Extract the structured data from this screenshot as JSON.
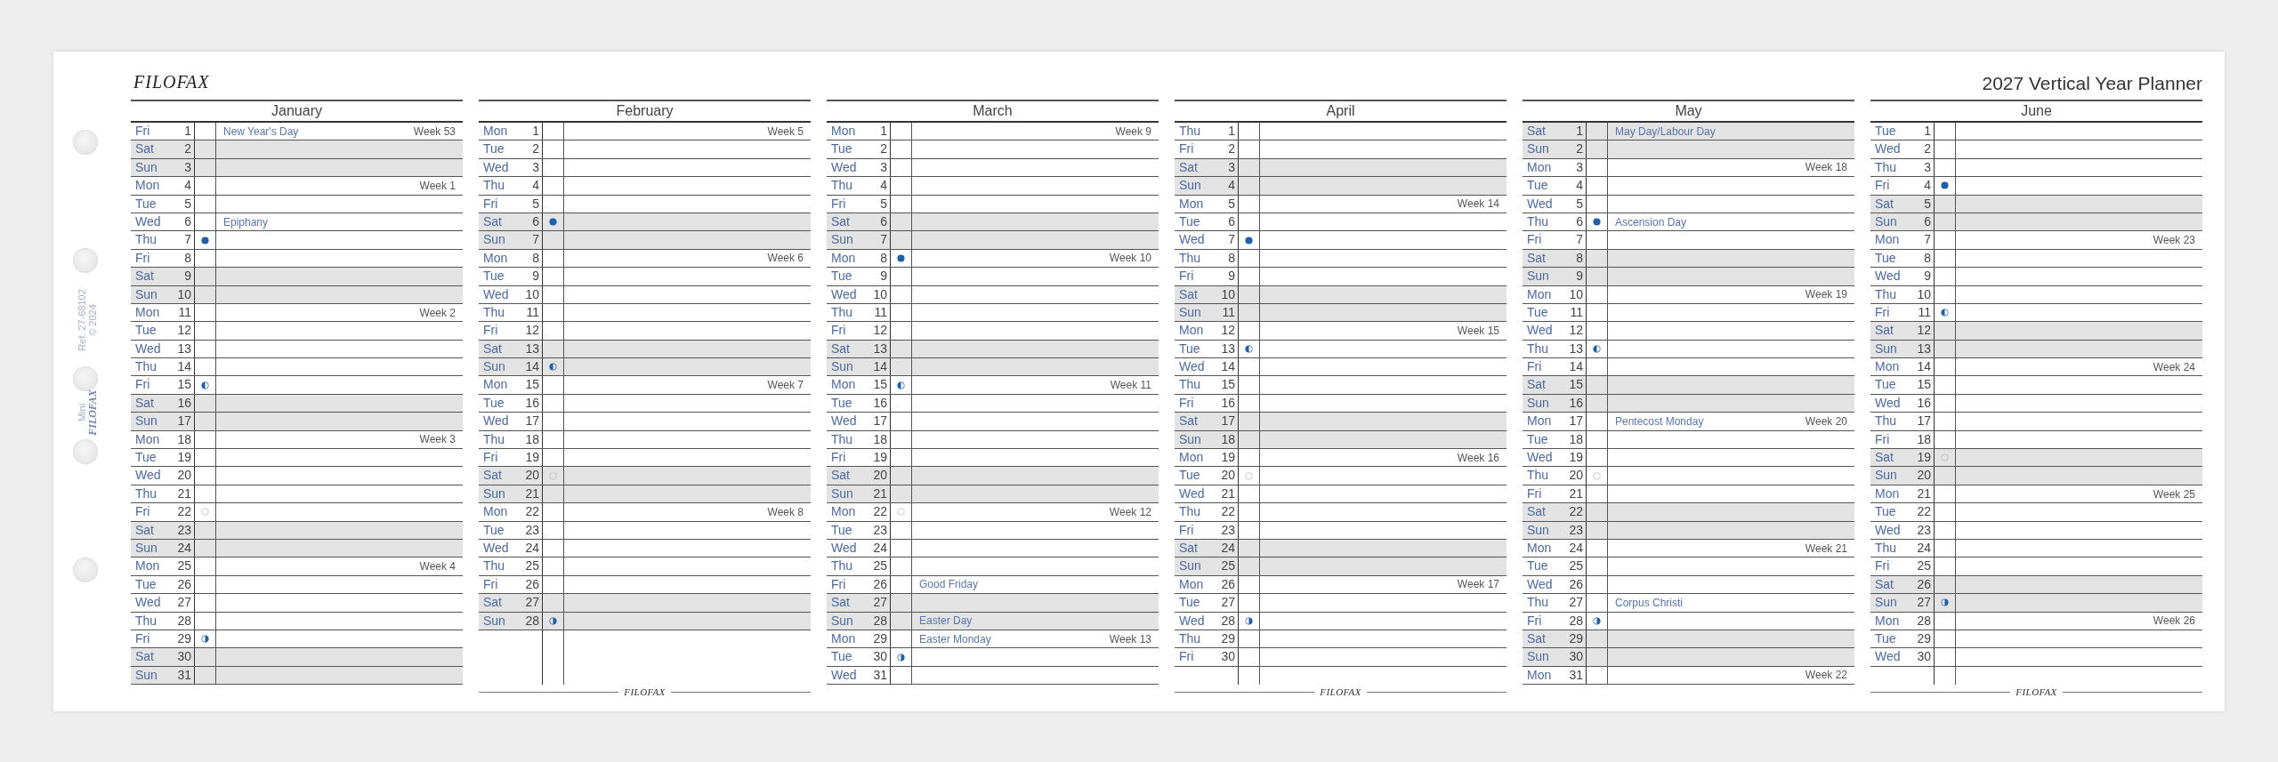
{
  "header": {
    "logo": "FILOFAX",
    "title": "2027 Vertical Year Planner"
  },
  "margin": {
    "reference": "Ref. 27-68102",
    "copyright": "© 2024",
    "edition": "Mini",
    "brand": "FILOFAX"
  },
  "months": [
    {
      "name": "January",
      "days": [
        {
          "weekday": "Fri",
          "date": "1",
          "shaded": false,
          "note": "New Year's Day",
          "week": "Week 53"
        },
        {
          "weekday": "Sat",
          "date": "2",
          "shaded": true
        },
        {
          "weekday": "Sun",
          "date": "3",
          "shaded": true
        },
        {
          "weekday": "Mon",
          "date": "4",
          "shaded": false,
          "week": "Week 1"
        },
        {
          "weekday": "Tue",
          "date": "5",
          "shaded": false
        },
        {
          "weekday": "Wed",
          "date": "6",
          "shaded": false,
          "note": "Epiphany"
        },
        {
          "weekday": "Thu",
          "date": "7",
          "shaded": false,
          "moon": {
            "kind": "new"
          }
        },
        {
          "weekday": "Fri",
          "date": "8",
          "shaded": false
        },
        {
          "weekday": "Sat",
          "date": "9",
          "shaded": true
        },
        {
          "weekday": "Sun",
          "date": "10",
          "shaded": true
        },
        {
          "weekday": "Mon",
          "date": "11",
          "shaded": false,
          "week": "Week 2"
        },
        {
          "weekday": "Tue",
          "date": "12",
          "shaded": false
        },
        {
          "weekday": "Wed",
          "date": "13",
          "shaded": false
        },
        {
          "weekday": "Thu",
          "date": "14",
          "shaded": false
        },
        {
          "weekday": "Fri",
          "date": "15",
          "shaded": false,
          "moon": {
            "kind": "first_quarter"
          }
        },
        {
          "weekday": "Sat",
          "date": "16",
          "shaded": true
        },
        {
          "weekday": "Sun",
          "date": "17",
          "shaded": true
        },
        {
          "weekday": "Mon",
          "date": "18",
          "shaded": false,
          "week": "Week 3"
        },
        {
          "weekday": "Tue",
          "date": "19",
          "shaded": false
        },
        {
          "weekday": "Wed",
          "date": "20",
          "shaded": false
        },
        {
          "weekday": "Thu",
          "date": "21",
          "shaded": false
        },
        {
          "weekday": "Fri",
          "date": "22",
          "shaded": false,
          "moon": {
            "kind": "full"
          }
        },
        {
          "weekday": "Sat",
          "date": "23",
          "shaded": true
        },
        {
          "weekday": "Sun",
          "date": "24",
          "shaded": true
        },
        {
          "weekday": "Mon",
          "date": "25",
          "shaded": false,
          "week": "Week 4"
        },
        {
          "weekday": "Tue",
          "date": "26",
          "shaded": false
        },
        {
          "weekday": "Wed",
          "date": "27",
          "shaded": false
        },
        {
          "weekday": "Thu",
          "date": "28",
          "shaded": false
        },
        {
          "weekday": "Fri",
          "date": "29",
          "shaded": false,
          "moon": {
            "kind": "last_quarter"
          }
        },
        {
          "weekday": "Sat",
          "date": "30",
          "shaded": true
        },
        {
          "weekday": "Sun",
          "date": "31",
          "shaded": true
        }
      ]
    },
    {
      "name": "February",
      "footer_logo": "FILOFAX",
      "days": [
        {
          "weekday": "Mon",
          "date": "1",
          "shaded": false,
          "week": "Week 5"
        },
        {
          "weekday": "Tue",
          "date": "2",
          "shaded": false
        },
        {
          "weekday": "Wed",
          "date": "3",
          "shaded": false
        },
        {
          "weekday": "Thu",
          "date": "4",
          "shaded": false
        },
        {
          "weekday": "Fri",
          "date": "5",
          "shaded": false
        },
        {
          "weekday": "Sat",
          "date": "6",
          "shaded": true,
          "moon": {
            "kind": "new"
          }
        },
        {
          "weekday": "Sun",
          "date": "7",
          "shaded": true
        },
        {
          "weekday": "Mon",
          "date": "8",
          "shaded": false,
          "week": "Week 6"
        },
        {
          "weekday": "Tue",
          "date": "9",
          "shaded": false
        },
        {
          "weekday": "Wed",
          "date": "10",
          "shaded": false
        },
        {
          "weekday": "Thu",
          "date": "11",
          "shaded": false
        },
        {
          "weekday": "Fri",
          "date": "12",
          "shaded": false
        },
        {
          "weekday": "Sat",
          "date": "13",
          "shaded": true
        },
        {
          "weekday": "Sun",
          "date": "14",
          "shaded": true,
          "moon": {
            "kind": "first_quarter"
          }
        },
        {
          "weekday": "Mon",
          "date": "15",
          "shaded": false,
          "week": "Week 7"
        },
        {
          "weekday": "Tue",
          "date": "16",
          "shaded": false
        },
        {
          "weekday": "Wed",
          "date": "17",
          "shaded": false
        },
        {
          "weekday": "Thu",
          "date": "18",
          "shaded": false
        },
        {
          "weekday": "Fri",
          "date": "19",
          "shaded": false
        },
        {
          "weekday": "Sat",
          "date": "20",
          "shaded": true,
          "moon": {
            "kind": "full"
          }
        },
        {
          "weekday": "Sun",
          "date": "21",
          "shaded": true
        },
        {
          "weekday": "Mon",
          "date": "22",
          "shaded": false,
          "week": "Week 8"
        },
        {
          "weekday": "Tue",
          "date": "23",
          "shaded": false
        },
        {
          "weekday": "Wed",
          "date": "24",
          "shaded": false
        },
        {
          "weekday": "Thu",
          "date": "25",
          "shaded": false
        },
        {
          "weekday": "Fri",
          "date": "26",
          "shaded": false
        },
        {
          "weekday": "Sat",
          "date": "27",
          "shaded": true
        },
        {
          "weekday": "Sun",
          "date": "28",
          "shaded": true,
          "moon": {
            "kind": "last_quarter"
          }
        }
      ]
    },
    {
      "name": "March",
      "days": [
        {
          "weekday": "Mon",
          "date": "1",
          "shaded": false,
          "week": "Week 9"
        },
        {
          "weekday": "Tue",
          "date": "2",
          "shaded": false
        },
        {
          "weekday": "Wed",
          "date": "3",
          "shaded": false
        },
        {
          "weekday": "Thu",
          "date": "4",
          "shaded": false
        },
        {
          "weekday": "Fri",
          "date": "5",
          "shaded": false
        },
        {
          "weekday": "Sat",
          "date": "6",
          "shaded": true
        },
        {
          "weekday": "Sun",
          "date": "7",
          "shaded": true
        },
        {
          "weekday": "Mon",
          "date": "8",
          "shaded": false,
          "moon": {
            "kind": "new"
          },
          "week": "Week 10"
        },
        {
          "weekday": "Tue",
          "date": "9",
          "shaded": false
        },
        {
          "weekday": "Wed",
          "date": "10",
          "shaded": false
        },
        {
          "weekday": "Thu",
          "date": "11",
          "shaded": false
        },
        {
          "weekday": "Fri",
          "date": "12",
          "shaded": false
        },
        {
          "weekday": "Sat",
          "date": "13",
          "shaded": true
        },
        {
          "weekday": "Sun",
          "date": "14",
          "shaded": true
        },
        {
          "weekday": "Mon",
          "date": "15",
          "shaded": false,
          "moon": {
            "kind": "first_quarter"
          },
          "week": "Week 11"
        },
        {
          "weekday": "Tue",
          "date": "16",
          "shaded": false
        },
        {
          "weekday": "Wed",
          "date": "17",
          "shaded": false
        },
        {
          "weekday": "Thu",
          "date": "18",
          "shaded": false
        },
        {
          "weekday": "Fri",
          "date": "19",
          "shaded": false
        },
        {
          "weekday": "Sat",
          "date": "20",
          "shaded": true
        },
        {
          "weekday": "Sun",
          "date": "21",
          "shaded": true
        },
        {
          "weekday": "Mon",
          "date": "22",
          "shaded": false,
          "moon": {
            "kind": "full"
          },
          "week": "Week 12"
        },
        {
          "weekday": "Tue",
          "date": "23",
          "shaded": false
        },
        {
          "weekday": "Wed",
          "date": "24",
          "shaded": false
        },
        {
          "weekday": "Thu",
          "date": "25",
          "shaded": false
        },
        {
          "weekday": "Fri",
          "date": "26",
          "shaded": false,
          "note": "Good Friday"
        },
        {
          "weekday": "Sat",
          "date": "27",
          "shaded": true
        },
        {
          "weekday": "Sun",
          "date": "28",
          "shaded": true,
          "note": "Easter Day"
        },
        {
          "weekday": "Mon",
          "date": "29",
          "shaded": false,
          "note": "Easter Monday",
          "week": "Week 13"
        },
        {
          "weekday": "Tue",
          "date": "30",
          "shaded": false,
          "moon": {
            "kind": "last_quarter"
          }
        },
        {
          "weekday": "Wed",
          "date": "31",
          "shaded": false
        }
      ]
    },
    {
      "name": "April",
      "footer_logo": "FILOFAX",
      "days": [
        {
          "weekday": "Thu",
          "date": "1",
          "shaded": false
        },
        {
          "weekday": "Fri",
          "date": "2",
          "shaded": false
        },
        {
          "weekday": "Sat",
          "date": "3",
          "shaded": true
        },
        {
          "weekday": "Sun",
          "date": "4",
          "shaded": true
        },
        {
          "weekday": "Mon",
          "date": "5",
          "shaded": false,
          "week": "Week 14"
        },
        {
          "weekday": "Tue",
          "date": "6",
          "shaded": false
        },
        {
          "weekday": "Wed",
          "date": "7",
          "shaded": false,
          "moon": {
            "kind": "new"
          }
        },
        {
          "weekday": "Thu",
          "date": "8",
          "shaded": false
        },
        {
          "weekday": "Fri",
          "date": "9",
          "shaded": false
        },
        {
          "weekday": "Sat",
          "date": "10",
          "shaded": true
        },
        {
          "weekday": "Sun",
          "date": "11",
          "shaded": true
        },
        {
          "weekday": "Mon",
          "date": "12",
          "shaded": false,
          "week": "Week 15"
        },
        {
          "weekday": "Tue",
          "date": "13",
          "shaded": false,
          "moon": {
            "kind": "first_quarter"
          }
        },
        {
          "weekday": "Wed",
          "date": "14",
          "shaded": false
        },
        {
          "weekday": "Thu",
          "date": "15",
          "shaded": false
        },
        {
          "weekday": "Fri",
          "date": "16",
          "shaded": false
        },
        {
          "weekday": "Sat",
          "date": "17",
          "shaded": true
        },
        {
          "weekday": "Sun",
          "date": "18",
          "shaded": true
        },
        {
          "weekday": "Mon",
          "date": "19",
          "shaded": false,
          "week": "Week 16"
        },
        {
          "weekday": "Tue",
          "date": "20",
          "shaded": false,
          "moon": {
            "kind": "full"
          }
        },
        {
          "weekday": "Wed",
          "date": "21",
          "shaded": false
        },
        {
          "weekday": "Thu",
          "date": "22",
          "shaded": false
        },
        {
          "weekday": "Fri",
          "date": "23",
          "shaded": false
        },
        {
          "weekday": "Sat",
          "date": "24",
          "shaded": true
        },
        {
          "weekday": "Sun",
          "date": "25",
          "shaded": true
        },
        {
          "weekday": "Mon",
          "date": "26",
          "shaded": false,
          "week": "Week 17"
        },
        {
          "weekday": "Tue",
          "date": "27",
          "shaded": false
        },
        {
          "weekday": "Wed",
          "date": "28",
          "shaded": false,
          "moon": {
            "kind": "last_quarter"
          }
        },
        {
          "weekday": "Thu",
          "date": "29",
          "shaded": false
        },
        {
          "weekday": "Fri",
          "date": "30",
          "shaded": false
        }
      ]
    },
    {
      "name": "May",
      "days": [
        {
          "weekday": "Sat",
          "date": "1",
          "shaded": true,
          "note": "May Day/Labour Day"
        },
        {
          "weekday": "Sun",
          "date": "2",
          "shaded": true
        },
        {
          "weekday": "Mon",
          "date": "3",
          "shaded": false,
          "week": "Week 18"
        },
        {
          "weekday": "Tue",
          "date": "4",
          "shaded": false
        },
        {
          "weekday": "Wed",
          "date": "5",
          "shaded": false
        },
        {
          "weekday": "Thu",
          "date": "6",
          "shaded": false,
          "moon": {
            "kind": "new"
          },
          "note": "Ascension Day"
        },
        {
          "weekday": "Fri",
          "date": "7",
          "shaded": false
        },
        {
          "weekday": "Sat",
          "date": "8",
          "shaded": true
        },
        {
          "weekday": "Sun",
          "date": "9",
          "shaded": true
        },
        {
          "weekday": "Mon",
          "date": "10",
          "shaded": false,
          "week": "Week 19"
        },
        {
          "weekday": "Tue",
          "date": "11",
          "shaded": false
        },
        {
          "weekday": "Wed",
          "date": "12",
          "shaded": false
        },
        {
          "weekday": "Thu",
          "date": "13",
          "shaded": false,
          "moon": {
            "kind": "first_quarter"
          }
        },
        {
          "weekday": "Fri",
          "date": "14",
          "shaded": false
        },
        {
          "weekday": "Sat",
          "date": "15",
          "shaded": true
        },
        {
          "weekday": "Sun",
          "date": "16",
          "shaded": true
        },
        {
          "weekday": "Mon",
          "date": "17",
          "shaded": false,
          "note": "Pentecost Monday",
          "week": "Week 20"
        },
        {
          "weekday": "Tue",
          "date": "18",
          "shaded": false
        },
        {
          "weekday": "Wed",
          "date": "19",
          "shaded": false
        },
        {
          "weekday": "Thu",
          "date": "20",
          "shaded": false,
          "moon": {
            "kind": "full"
          }
        },
        {
          "weekday": "Fri",
          "date": "21",
          "shaded": false
        },
        {
          "weekday": "Sat",
          "date": "22",
          "shaded": true
        },
        {
          "weekday": "Sun",
          "date": "23",
          "shaded": true
        },
        {
          "weekday": "Mon",
          "date": "24",
          "shaded": false,
          "week": "Week 21"
        },
        {
          "weekday": "Tue",
          "date": "25",
          "shaded": false
        },
        {
          "weekday": "Wed",
          "date": "26",
          "shaded": false
        },
        {
          "weekday": "Thu",
          "date": "27",
          "shaded": false,
          "note": "Corpus Christi"
        },
        {
          "weekday": "Fri",
          "date": "28",
          "shaded": false,
          "moon": {
            "kind": "last_quarter"
          }
        },
        {
          "weekday": "Sat",
          "date": "29",
          "shaded": true
        },
        {
          "weekday": "Sun",
          "date": "30",
          "shaded": true
        },
        {
          "weekday": "Mon",
          "date": "31",
          "shaded": false,
          "week": "Week 22"
        }
      ]
    },
    {
      "name": "June",
      "footer_logo": "FILOFAX",
      "days": [
        {
          "weekday": "Tue",
          "date": "1",
          "shaded": false
        },
        {
          "weekday": "Wed",
          "date": "2",
          "shaded": false
        },
        {
          "weekday": "Thu",
          "date": "3",
          "shaded": false
        },
        {
          "weekday": "Fri",
          "date": "4",
          "shaded": false,
          "moon": {
            "kind": "new"
          }
        },
        {
          "weekday": "Sat",
          "date": "5",
          "shaded": true
        },
        {
          "weekday": "Sun",
          "date": "6",
          "shaded": true
        },
        {
          "weekday": "Mon",
          "date": "7",
          "shaded": false,
          "week": "Week 23"
        },
        {
          "weekday": "Tue",
          "date": "8",
          "shaded": false
        },
        {
          "weekday": "Wed",
          "date": "9",
          "shaded": false
        },
        {
          "weekday": "Thu",
          "date": "10",
          "shaded": false
        },
        {
          "weekday": "Fri",
          "date": "11",
          "shaded": false,
          "moon": {
            "kind": "first_quarter"
          }
        },
        {
          "weekday": "Sat",
          "date": "12",
          "shaded": true
        },
        {
          "weekday": "Sun",
          "date": "13",
          "shaded": true
        },
        {
          "weekday": "Mon",
          "date": "14",
          "shaded": false,
          "week": "Week 24"
        },
        {
          "weekday": "Tue",
          "date": "15",
          "shaded": false
        },
        {
          "weekday": "Wed",
          "date": "16",
          "shaded": false
        },
        {
          "weekday": "Thu",
          "date": "17",
          "shaded": false
        },
        {
          "weekday": "Fri",
          "date": "18",
          "shaded": false
        },
        {
          "weekday": "Sat",
          "date": "19",
          "shaded": true,
          "moon": {
            "kind": "full"
          }
        },
        {
          "weekday": "Sun",
          "date": "20",
          "shaded": true
        },
        {
          "weekday": "Mon",
          "date": "21",
          "shaded": false,
          "week": "Week 25"
        },
        {
          "weekday": "Tue",
          "date": "22",
          "shaded": false
        },
        {
          "weekday": "Wed",
          "date": "23",
          "shaded": false
        },
        {
          "weekday": "Thu",
          "date": "24",
          "shaded": false
        },
        {
          "weekday": "Fri",
          "date": "25",
          "shaded": false
        },
        {
          "weekday": "Sat",
          "date": "26",
          "shaded": true
        },
        {
          "weekday": "Sun",
          "date": "27",
          "shaded": true,
          "moon": {
            "kind": "last_quarter"
          }
        },
        {
          "weekday": "Mon",
          "date": "28",
          "shaded": false,
          "week": "Week 26"
        },
        {
          "weekday": "Tue",
          "date": "29",
          "shaded": false
        },
        {
          "weekday": "Wed",
          "date": "30",
          "shaded": false
        }
      ]
    }
  ]
}
